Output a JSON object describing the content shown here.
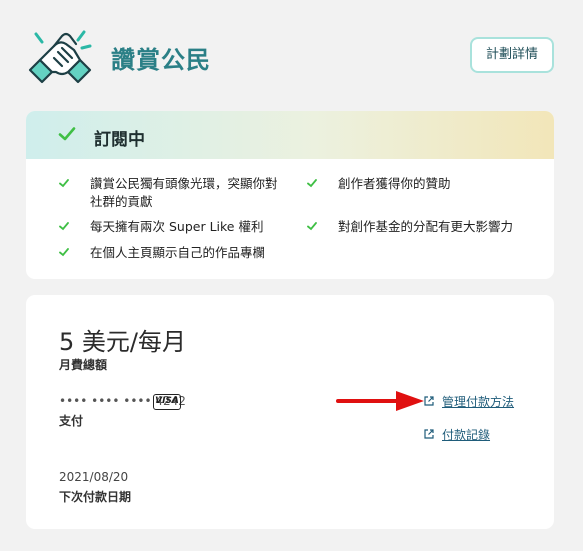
{
  "header": {
    "title": "讚賞公民",
    "plan_button_label": "計劃詳情"
  },
  "subscription": {
    "status": "訂閱中",
    "benefits": [
      "讚賞公民獨有頭像光環，突顯你對社群的貢獻",
      "每天擁有兩次 Super Like 權利",
      "在個人主頁顯示自己的作品專欄",
      "創作者獲得你的贊助",
      "對創作基金的分配有更大影響力"
    ]
  },
  "billing": {
    "price": "5 美元/每月",
    "price_label": "月費總額",
    "card_number": "•••• •••• •••• 4242",
    "card_brand": "VISA",
    "payment_label": "支付",
    "manage_link": "管理付款方法",
    "history_link": "付款記錄",
    "next_date": "2021/08/20",
    "next_date_label": "下次付款日期"
  },
  "colors": {
    "accent": "#2a7f86",
    "check": "#3fbf45",
    "arrow": "#e01010",
    "button_border": "#a9e2dc"
  },
  "icons": {
    "logo": "handshake-logo-icon",
    "check": "check-icon",
    "external": "external-link-icon"
  }
}
